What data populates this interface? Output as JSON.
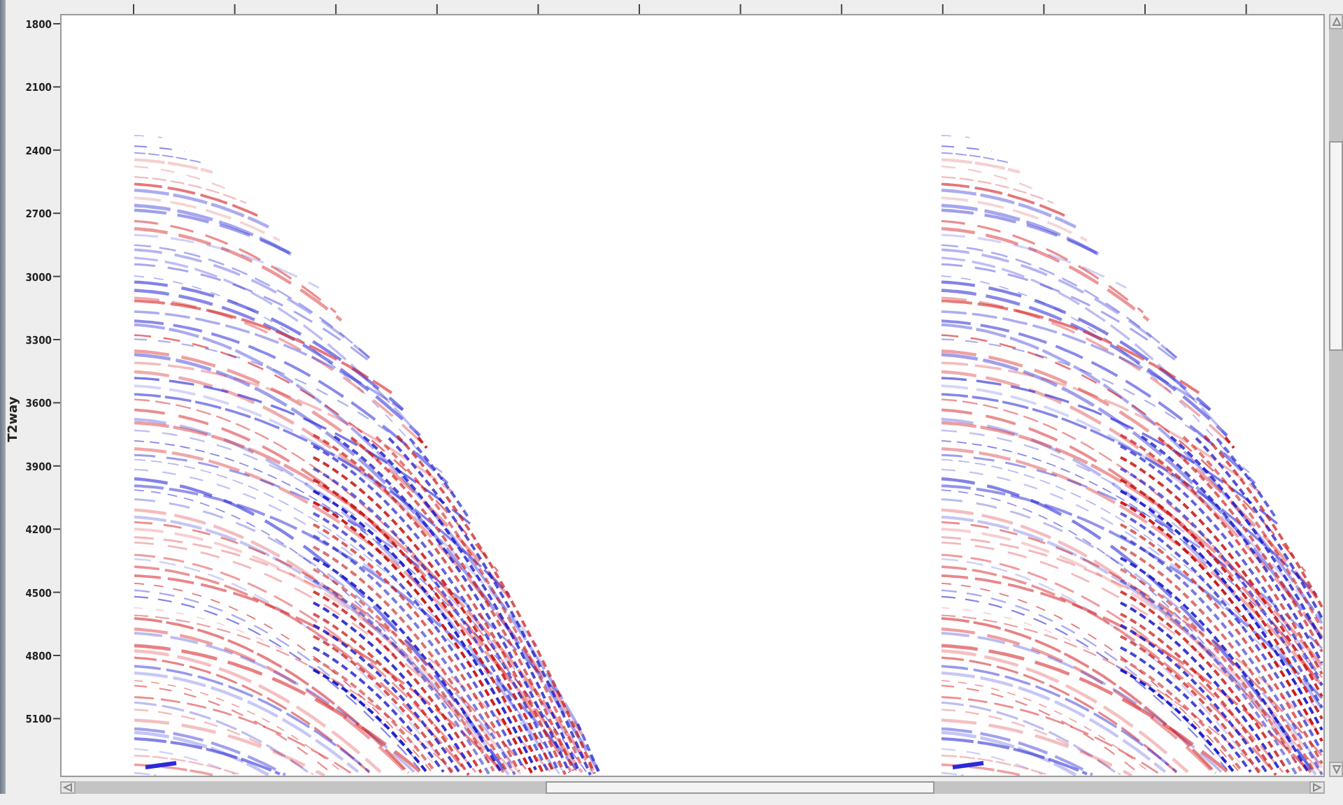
{
  "y_axis": {
    "label": "T2way",
    "ticks": [
      "1800",
      "2100",
      "2400",
      "2700",
      "3000",
      "3300",
      "3600",
      "3900",
      "4200",
      "4500",
      "4800",
      "5100"
    ]
  }
}
